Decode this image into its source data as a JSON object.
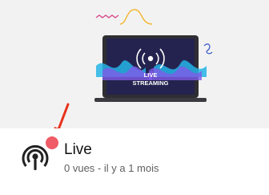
{
  "thumbnail": {
    "line1": "LIVE",
    "line2": "STREAMING",
    "screen_color": "#2b2a6b",
    "glow_color": "#5b55e0"
  },
  "annotation": {
    "arrow_color": "#e8321c"
  },
  "item": {
    "title": "Live",
    "meta": "0 vues - il y a 1 mois",
    "icon": "podcast-icon",
    "badge_color": "#ef5b66"
  }
}
